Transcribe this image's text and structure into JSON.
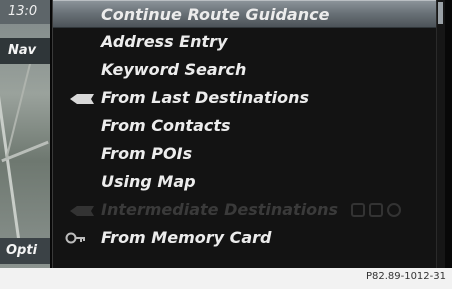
{
  "status": {
    "time": "13:0",
    "nav_label": "Nav",
    "options_label": "Opti"
  },
  "menu": {
    "items": [
      {
        "label": "Continue Route Guidance",
        "state": "selected"
      },
      {
        "label": "Address Entry",
        "state": "normal"
      },
      {
        "label": "Keyword Search",
        "state": "normal"
      },
      {
        "label": "From Last Destinations",
        "state": "normal",
        "icon": "flag-icon"
      },
      {
        "label": "From Contacts",
        "state": "normal"
      },
      {
        "label": "From POIs",
        "state": "normal"
      },
      {
        "label": "Using Map",
        "state": "normal"
      },
      {
        "label": "Intermediate Destinations",
        "state": "disabled",
        "icon": "flag-icon"
      },
      {
        "label": "From Memory Card",
        "state": "normal",
        "icon": "memory-card-icon"
      }
    ]
  },
  "figure_code": "P82.89-1012-31"
}
